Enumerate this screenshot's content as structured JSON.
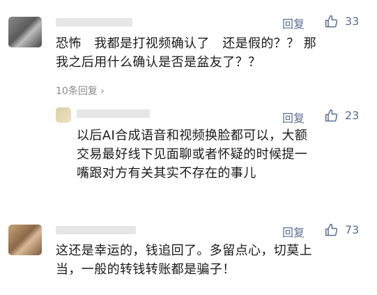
{
  "comments": [
    {
      "reply_label": "回复",
      "likes": "33",
      "lines": [
        "恐怖　我都是打视频确认了　还是假的？？ 那",
        "我之后用什么确认是否是盆友了？？"
      ],
      "replies_link": "10条回复",
      "replies_chevron": "›"
    },
    {
      "reply_label": "回复",
      "likes": "23",
      "lines": [
        "以后AI合成语音和视频换脸都可以，大额",
        "交易最好线下见面聊或者怀疑的时候提一",
        "嘴跟对方有关其实不存在的事儿"
      ]
    },
    {
      "reply_label": "回复",
      "likes": "73",
      "lines": [
        "这还是幸运的，钱追回了。多留点心，切莫上",
        "当，一般的转钱转账都是骗子！"
      ]
    }
  ],
  "icons": {
    "like": "thumbs-up-icon"
  },
  "colors": {
    "action": "#5b6f94",
    "muted": "#8a8a8a"
  }
}
